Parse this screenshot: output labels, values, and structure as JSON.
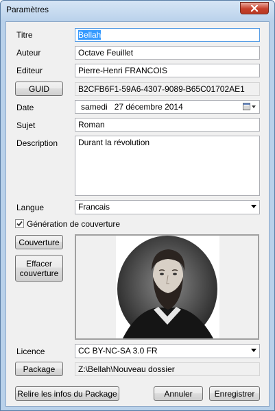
{
  "window": {
    "title": "Paramètres"
  },
  "labels": {
    "titre": "Titre",
    "auteur": "Auteur",
    "editeur": "Editeur",
    "date": "Date",
    "sujet": "Sujet",
    "description": "Description",
    "langue": "Langue",
    "licence": "Licence"
  },
  "fields": {
    "titre": "Bellah",
    "auteur": "Octave Feuillet",
    "editeur": "Pierre-Henri FRANCOIS",
    "guid": "B2CFB6F1-59A6-4307-9089-B65C01702AE1",
    "date_weekday": "samedi",
    "date_value": "27 décembre 2014",
    "sujet": "Roman",
    "description": "Durant la révolution",
    "langue": "Francais",
    "licence": "CC BY-NC-SA 3.0 FR",
    "package": "Z:\\Bellah\\Nouveau dossier"
  },
  "buttons": {
    "guid": "GUID",
    "couverture": "Couverture",
    "effacer_line1": "Effacer",
    "effacer_line2": "couverture",
    "package": "Package",
    "relire": "Relire les infos du Package",
    "annuler": "Annuler",
    "enregistrer": "Enregistrer"
  },
  "checkbox": {
    "label": "Génération de couverture",
    "checked": true
  }
}
